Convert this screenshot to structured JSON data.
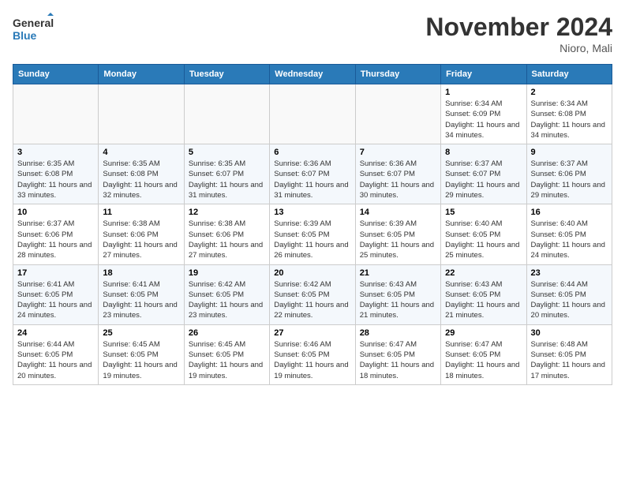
{
  "logo": {
    "line1": "General",
    "line2": "Blue"
  },
  "title": "November 2024",
  "location": "Nioro, Mali",
  "days_of_week": [
    "Sunday",
    "Monday",
    "Tuesday",
    "Wednesday",
    "Thursday",
    "Friday",
    "Saturday"
  ],
  "weeks": [
    [
      {
        "day": "",
        "info": ""
      },
      {
        "day": "",
        "info": ""
      },
      {
        "day": "",
        "info": ""
      },
      {
        "day": "",
        "info": ""
      },
      {
        "day": "",
        "info": ""
      },
      {
        "day": "1",
        "info": "Sunrise: 6:34 AM\nSunset: 6:09 PM\nDaylight: 11 hours and 34 minutes."
      },
      {
        "day": "2",
        "info": "Sunrise: 6:34 AM\nSunset: 6:08 PM\nDaylight: 11 hours and 34 minutes."
      }
    ],
    [
      {
        "day": "3",
        "info": "Sunrise: 6:35 AM\nSunset: 6:08 PM\nDaylight: 11 hours and 33 minutes."
      },
      {
        "day": "4",
        "info": "Sunrise: 6:35 AM\nSunset: 6:08 PM\nDaylight: 11 hours and 32 minutes."
      },
      {
        "day": "5",
        "info": "Sunrise: 6:35 AM\nSunset: 6:07 PM\nDaylight: 11 hours and 31 minutes."
      },
      {
        "day": "6",
        "info": "Sunrise: 6:36 AM\nSunset: 6:07 PM\nDaylight: 11 hours and 31 minutes."
      },
      {
        "day": "7",
        "info": "Sunrise: 6:36 AM\nSunset: 6:07 PM\nDaylight: 11 hours and 30 minutes."
      },
      {
        "day": "8",
        "info": "Sunrise: 6:37 AM\nSunset: 6:07 PM\nDaylight: 11 hours and 29 minutes."
      },
      {
        "day": "9",
        "info": "Sunrise: 6:37 AM\nSunset: 6:06 PM\nDaylight: 11 hours and 29 minutes."
      }
    ],
    [
      {
        "day": "10",
        "info": "Sunrise: 6:37 AM\nSunset: 6:06 PM\nDaylight: 11 hours and 28 minutes."
      },
      {
        "day": "11",
        "info": "Sunrise: 6:38 AM\nSunset: 6:06 PM\nDaylight: 11 hours and 27 minutes."
      },
      {
        "day": "12",
        "info": "Sunrise: 6:38 AM\nSunset: 6:06 PM\nDaylight: 11 hours and 27 minutes."
      },
      {
        "day": "13",
        "info": "Sunrise: 6:39 AM\nSunset: 6:05 PM\nDaylight: 11 hours and 26 minutes."
      },
      {
        "day": "14",
        "info": "Sunrise: 6:39 AM\nSunset: 6:05 PM\nDaylight: 11 hours and 25 minutes."
      },
      {
        "day": "15",
        "info": "Sunrise: 6:40 AM\nSunset: 6:05 PM\nDaylight: 11 hours and 25 minutes."
      },
      {
        "day": "16",
        "info": "Sunrise: 6:40 AM\nSunset: 6:05 PM\nDaylight: 11 hours and 24 minutes."
      }
    ],
    [
      {
        "day": "17",
        "info": "Sunrise: 6:41 AM\nSunset: 6:05 PM\nDaylight: 11 hours and 24 minutes."
      },
      {
        "day": "18",
        "info": "Sunrise: 6:41 AM\nSunset: 6:05 PM\nDaylight: 11 hours and 23 minutes."
      },
      {
        "day": "19",
        "info": "Sunrise: 6:42 AM\nSunset: 6:05 PM\nDaylight: 11 hours and 23 minutes."
      },
      {
        "day": "20",
        "info": "Sunrise: 6:42 AM\nSunset: 6:05 PM\nDaylight: 11 hours and 22 minutes."
      },
      {
        "day": "21",
        "info": "Sunrise: 6:43 AM\nSunset: 6:05 PM\nDaylight: 11 hours and 21 minutes."
      },
      {
        "day": "22",
        "info": "Sunrise: 6:43 AM\nSunset: 6:05 PM\nDaylight: 11 hours and 21 minutes."
      },
      {
        "day": "23",
        "info": "Sunrise: 6:44 AM\nSunset: 6:05 PM\nDaylight: 11 hours and 20 minutes."
      }
    ],
    [
      {
        "day": "24",
        "info": "Sunrise: 6:44 AM\nSunset: 6:05 PM\nDaylight: 11 hours and 20 minutes."
      },
      {
        "day": "25",
        "info": "Sunrise: 6:45 AM\nSunset: 6:05 PM\nDaylight: 11 hours and 19 minutes."
      },
      {
        "day": "26",
        "info": "Sunrise: 6:45 AM\nSunset: 6:05 PM\nDaylight: 11 hours and 19 minutes."
      },
      {
        "day": "27",
        "info": "Sunrise: 6:46 AM\nSunset: 6:05 PM\nDaylight: 11 hours and 19 minutes."
      },
      {
        "day": "28",
        "info": "Sunrise: 6:47 AM\nSunset: 6:05 PM\nDaylight: 11 hours and 18 minutes."
      },
      {
        "day": "29",
        "info": "Sunrise: 6:47 AM\nSunset: 6:05 PM\nDaylight: 11 hours and 18 minutes."
      },
      {
        "day": "30",
        "info": "Sunrise: 6:48 AM\nSunset: 6:05 PM\nDaylight: 11 hours and 17 minutes."
      }
    ]
  ]
}
